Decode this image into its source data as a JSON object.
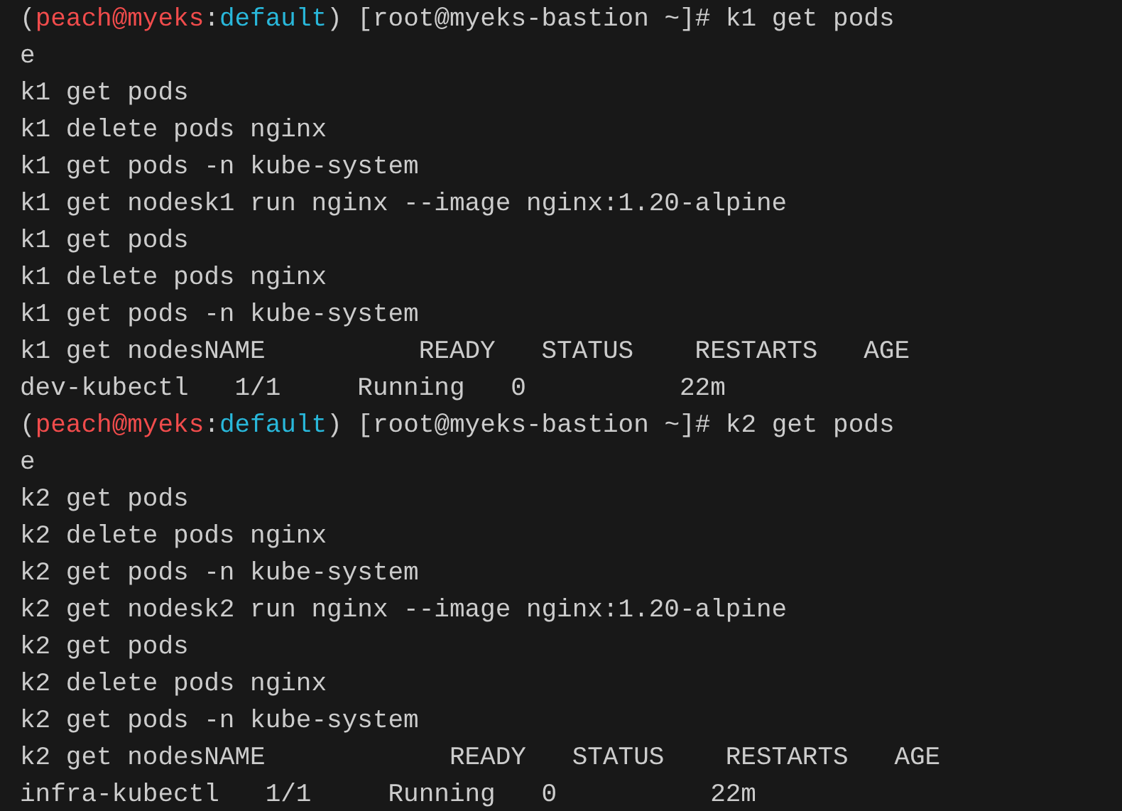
{
  "terminal": {
    "lines": [
      {
        "kind": "prompt",
        "segments": [
          {
            "kind": "plain",
            "text": "("
          },
          {
            "kind": "user",
            "text": "peach@myeks"
          },
          {
            "kind": "plain",
            "text": ":"
          },
          {
            "kind": "context",
            "text": "default"
          },
          {
            "kind": "plain",
            "text": ") [root@myeks-bastion ~]# k1 get pods"
          }
        ]
      },
      {
        "kind": "output",
        "text": "e"
      },
      {
        "kind": "output",
        "text": "k1 get pods"
      },
      {
        "kind": "output",
        "text": "k1 delete pods nginx"
      },
      {
        "kind": "output",
        "text": "k1 get pods -n kube-system"
      },
      {
        "kind": "output",
        "text": "k1 get nodesk1 run nginx --image nginx:1.20-alpine"
      },
      {
        "kind": "output",
        "text": "k1 get pods"
      },
      {
        "kind": "output",
        "text": "k1 delete pods nginx"
      },
      {
        "kind": "output",
        "text": "k1 get pods -n kube-system"
      },
      {
        "kind": "output",
        "text": "k1 get nodesNAME          READY   STATUS    RESTARTS   AGE"
      },
      {
        "kind": "output",
        "text": "dev-kubectl   1/1     Running   0          22m"
      },
      {
        "kind": "prompt",
        "segments": [
          {
            "kind": "plain",
            "text": "("
          },
          {
            "kind": "user",
            "text": "peach@myeks"
          },
          {
            "kind": "plain",
            "text": ":"
          },
          {
            "kind": "context",
            "text": "default"
          },
          {
            "kind": "plain",
            "text": ") [root@myeks-bastion ~]# k2 get pods"
          }
        ]
      },
      {
        "kind": "output",
        "text": "e"
      },
      {
        "kind": "output",
        "text": "k2 get pods"
      },
      {
        "kind": "output",
        "text": "k2 delete pods nginx"
      },
      {
        "kind": "output",
        "text": "k2 get pods -n kube-system"
      },
      {
        "kind": "output",
        "text": "k2 get nodesk2 run nginx --image nginx:1.20-alpine"
      },
      {
        "kind": "output",
        "text": "k2 get pods"
      },
      {
        "kind": "output",
        "text": "k2 delete pods nginx"
      },
      {
        "kind": "output",
        "text": "k2 get pods -n kube-system"
      },
      {
        "kind": "output",
        "text": "k2 get nodesNAME            READY   STATUS    RESTARTS   AGE"
      },
      {
        "kind": "output",
        "text": "infra-kubectl   1/1     Running   0          22m"
      }
    ]
  }
}
